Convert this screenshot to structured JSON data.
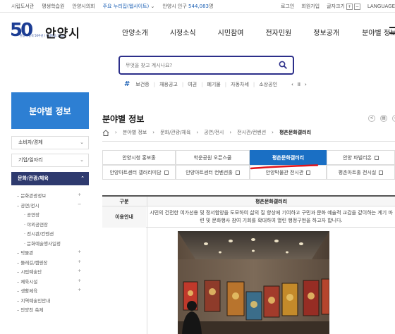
{
  "topbar": {
    "left_links": [
      "시립도서관",
      "평생학습원",
      "안양시의회"
    ],
    "sites_dropdown": "주요 누리집(웹사이트)",
    "population_label": "안양시 인구",
    "population_value": "544,083",
    "population_unit": "명",
    "right_links": [
      "로그인",
      "회원가입"
    ],
    "font_size_label": "글자크기",
    "font_plus": "+",
    "font_minus": "−",
    "language_label": "LANGUAGE"
  },
  "header": {
    "logo_number": "50",
    "logo_sub": "안양시 승격 50주년 / 평생학습 100년",
    "logo_name": "안양시",
    "gnb": [
      "안양소개",
      "시정소식",
      "시민참여",
      "전자민원",
      "정보공개",
      "분야별 정보"
    ]
  },
  "search": {
    "placeholder": "무엇을 찾고 계시나요?",
    "hashtags": [
      "보건증",
      "채용공고",
      "여권",
      "폐기물",
      "자동차세",
      "소상공인"
    ],
    "ctrl_prev": "‹",
    "ctrl_pause": "II",
    "ctrl_next": "›"
  },
  "sidebar": {
    "title": "분야별 정보",
    "items": [
      "소비자/경제",
      "기업/일자리"
    ],
    "active_item": "문화/관광/체육",
    "sub_items": [
      {
        "label": "문화관광정보",
        "level": 1,
        "caret": "+"
      },
      {
        "label": "공연/전시",
        "level": 1,
        "caret": "−"
      },
      {
        "label": "공연장",
        "level": 2
      },
      {
        "label": "야외공연장",
        "level": 2
      },
      {
        "label": "전시관/컨벤션",
        "level": 2
      },
      {
        "label": "문화예술행사일정",
        "level": 2
      },
      {
        "label": "박물관",
        "level": 1,
        "caret": "+"
      },
      {
        "label": "둘레길/캠핑장",
        "level": 1,
        "caret": "+"
      },
      {
        "label": "시립예술단",
        "level": 1,
        "caret": "+"
      },
      {
        "label": "체육시설",
        "level": 1,
        "caret": "+"
      },
      {
        "label": "생활체육",
        "level": 1,
        "caret": "+"
      },
      {
        "label": "지역예술인안내",
        "level": 1
      },
      {
        "label": "안양천 축제",
        "level": 1
      }
    ]
  },
  "content": {
    "title": "분야별 정보",
    "breadcrumb": [
      "분야별 정보",
      "문화/관광/체육",
      "공연/전시",
      "전시관/컨벤션",
      "평촌문화갤러리"
    ],
    "tabs_row1": [
      "안양시청 홍보홀",
      "학운공원 오픈스쿨",
      "평촌문화갤러리",
      "안양 파빌리온"
    ],
    "tabs_row2": [
      "안양아트센터 갤러리미담",
      "안양아트센터 컨벤션홀",
      "안양박물관 전시관",
      "평촌아트홀 전시실"
    ],
    "table": {
      "head_key": "구분",
      "head_value": "평촌문화갤러리",
      "row_key": "이용안내",
      "row_value_line1": "시민의 건전한 여가선용 및 정서함양을 도모하여 삶의 질 향상에 기여하고 구민과 문화 예술적 교감을 같이하는 계기 마",
      "row_value_line2": "련 및 문화행사 참여 기회를 확대하여 열린 행정구현을 하고자 합니다."
    }
  },
  "colors": {
    "primary": "#2d7fd3",
    "active_tab": "#1a6fc4",
    "sidebar_active": "#2e3a6e",
    "annotation": "#e0141b"
  }
}
